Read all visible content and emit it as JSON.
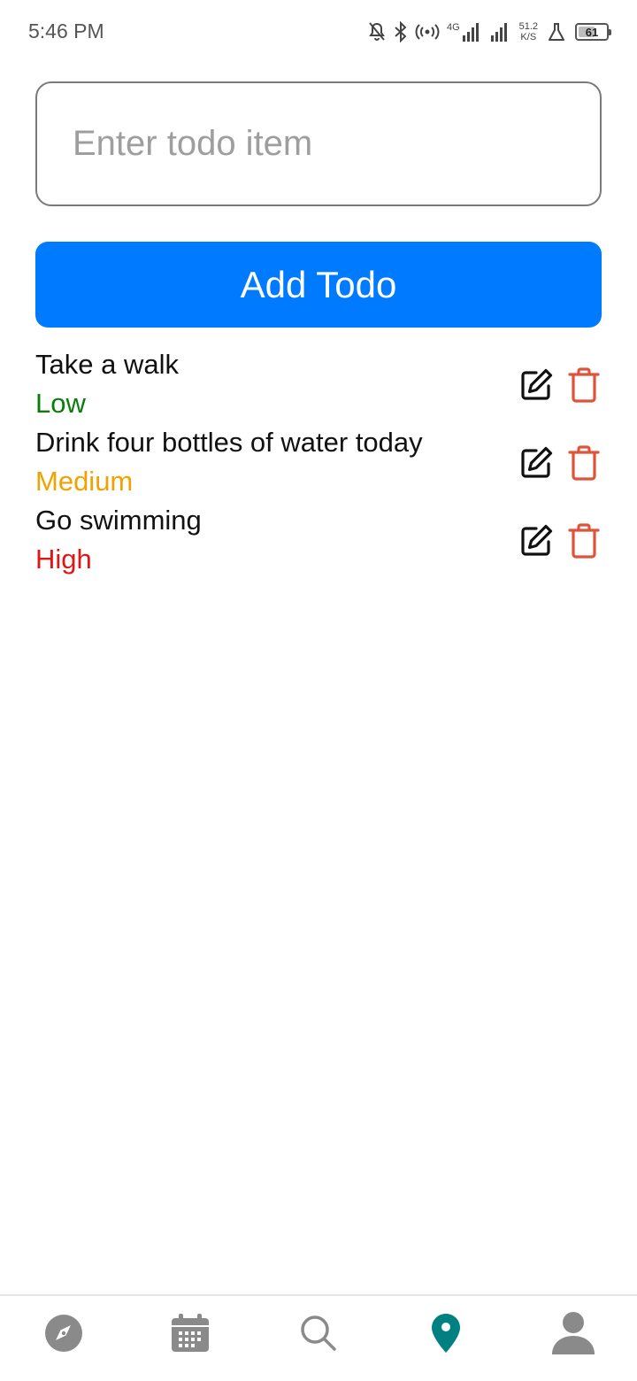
{
  "status_bar": {
    "time": "5:46 PM",
    "network_speed_value": "51.2",
    "network_speed_unit": "K/S",
    "battery_level": "61",
    "network_type": "4G"
  },
  "form": {
    "input_placeholder": "Enter todo item",
    "input_value": "",
    "add_button_label": "Add Todo"
  },
  "todos": [
    {
      "title": "Take a walk",
      "priority": "Low",
      "priority_color": "#0a7d0a"
    },
    {
      "title": "Drink four bottles of water today",
      "priority": "Medium",
      "priority_color": "#f0a300"
    },
    {
      "title": "Go swimming",
      "priority": "High",
      "priority_color": "#e01515"
    }
  ],
  "colors": {
    "accent": "#007bff",
    "delete_icon": "#e0533a",
    "nav_active": "#008080",
    "nav_inactive": "#8a8a8a"
  },
  "bottom_nav": {
    "items": [
      {
        "icon": "compass-icon",
        "active": false
      },
      {
        "icon": "calendar-icon",
        "active": false
      },
      {
        "icon": "search-icon",
        "active": false
      },
      {
        "icon": "location-pin-icon",
        "active": true
      },
      {
        "icon": "person-icon",
        "active": false
      }
    ]
  }
}
